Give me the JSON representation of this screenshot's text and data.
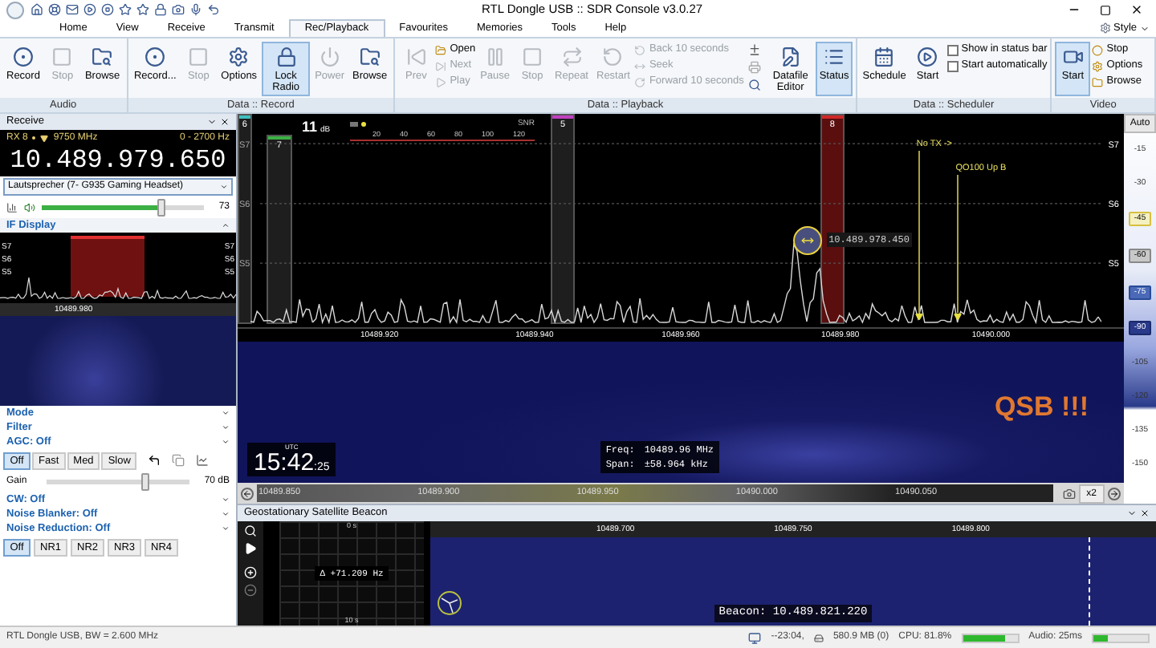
{
  "window": {
    "title": "RTL Dongle USB :: SDR Console v3.0.27"
  },
  "tabs": [
    {
      "label": "Home",
      "selected": false
    },
    {
      "label": "View",
      "selected": false
    },
    {
      "label": "Receive",
      "selected": false
    },
    {
      "label": "Transmit",
      "selected": false
    },
    {
      "label": "Rec/Playback",
      "selected": true
    },
    {
      "label": "Favourites",
      "selected": false
    },
    {
      "label": "Memories",
      "selected": false
    },
    {
      "label": "Tools",
      "selected": false
    },
    {
      "label": "Help",
      "selected": false
    }
  ],
  "style_menu": {
    "label": "Style"
  },
  "ribbon": {
    "groups": [
      {
        "label": "Audio",
        "items": [
          {
            "kind": "large",
            "label": "Record",
            "disabled": false,
            "selected": false
          },
          {
            "kind": "large",
            "label": "Stop",
            "disabled": true,
            "selected": false
          },
          {
            "kind": "large",
            "label": "Browse",
            "disabled": false,
            "selected": false
          }
        ]
      },
      {
        "label": "Data :: Record",
        "items": [
          {
            "kind": "large",
            "label": "Record...",
            "disabled": false,
            "selected": false
          },
          {
            "kind": "large",
            "label": "Stop",
            "disabled": true,
            "selected": false
          },
          {
            "kind": "large",
            "label": "Options",
            "disabled": false,
            "selected": false
          },
          {
            "kind": "large",
            "label": "Lock Radio",
            "disabled": false,
            "selected": true
          },
          {
            "kind": "large",
            "label": "Power",
            "disabled": true,
            "selected": false
          },
          {
            "kind": "large",
            "label": "Browse",
            "disabled": false,
            "selected": false
          }
        ]
      },
      {
        "label": "Data :: Playback",
        "items": [
          {
            "kind": "large",
            "label": "Prev",
            "disabled": true,
            "selected": false
          },
          {
            "kind": "small",
            "label": "Open",
            "disabled": false
          },
          {
            "kind": "small",
            "label": "Next",
            "disabled": true
          },
          {
            "kind": "small",
            "label": "Play",
            "disabled": true
          },
          {
            "kind": "large",
            "label": "Pause",
            "disabled": true,
            "selected": false
          },
          {
            "kind": "large",
            "label": "Stop",
            "disabled": true,
            "selected": false
          },
          {
            "kind": "large",
            "label": "Repeat",
            "disabled": true,
            "selected": false
          },
          {
            "kind": "large",
            "label": "Restart",
            "disabled": true,
            "selected": false
          },
          {
            "kind": "small",
            "label": "Back 10 seconds",
            "disabled": true
          },
          {
            "kind": "small",
            "label": "Seek",
            "disabled": true
          },
          {
            "kind": "small",
            "label": "Forward 10 seconds",
            "disabled": true
          },
          {
            "kind": "tools"
          },
          {
            "kind": "large",
            "label": "Datafile Editor",
            "disabled": false,
            "selected": false
          },
          {
            "kind": "large",
            "label": "Status",
            "disabled": false,
            "selected": true
          }
        ]
      },
      {
        "label": "Data :: Scheduler",
        "items": [
          {
            "kind": "large",
            "label": "Schedule",
            "disabled": false,
            "selected": false
          },
          {
            "kind": "large",
            "label": "Start",
            "disabled": false,
            "selected": false
          },
          {
            "kind": "check",
            "label": "Show in status bar",
            "checked": false
          },
          {
            "kind": "check",
            "label": "Start automatically",
            "checked": false
          }
        ]
      },
      {
        "label": "Video",
        "items": [
          {
            "kind": "large",
            "label": "Start",
            "disabled": false,
            "selected": true
          },
          {
            "kind": "small",
            "label": "Stop",
            "disabled": false
          },
          {
            "kind": "small",
            "label": "Options",
            "disabled": false
          },
          {
            "kind": "small",
            "label": "Browse",
            "disabled": false
          }
        ]
      }
    ]
  },
  "receive_panel": {
    "title": "Receive",
    "rx": "RX 8",
    "lo": "9750 MHz",
    "bandwidth": "0 - 2700 Hz",
    "frequency": "10.489.979.650",
    "audio_device": "Lautsprecher (7- G935 Gaming Headset)",
    "volume": {
      "level": 0.73,
      "reading": "73"
    },
    "if_display": {
      "title": "IF Display",
      "s_labels_left": [
        "S7",
        "S6",
        "S5"
      ],
      "s_labels_right": [
        "S7",
        "S6",
        "S5"
      ],
      "frequency_label": "10489.980"
    },
    "sections": [
      {
        "label": "Mode"
      },
      {
        "label": "Filter"
      },
      {
        "label": "AGC: Off"
      }
    ],
    "agc_buttons": [
      {
        "label": "Off",
        "selected": true
      },
      {
        "label": "Fast",
        "selected": false
      },
      {
        "label": "Med",
        "selected": false
      },
      {
        "label": "Slow",
        "selected": false
      }
    ],
    "gain": {
      "label": "Gain",
      "level": 0.68,
      "reading": "70 dB"
    },
    "sections2": [
      {
        "label": "CW: Off"
      },
      {
        "label": "Noise Blanker: Off"
      },
      {
        "label": "Noise Reduction: Off"
      }
    ],
    "nr_buttons": [
      {
        "label": "Off",
        "selected": true
      },
      {
        "label": "NR1",
        "selected": false
      },
      {
        "label": "NR2",
        "selected": false
      },
      {
        "label": "NR3",
        "selected": false
      },
      {
        "label": "NR4",
        "selected": false
      }
    ]
  },
  "spectrum": {
    "snr_reading": "11",
    "snr_unit": "dB",
    "snr_label": "SNR",
    "snr_ticks": [
      "20",
      "40",
      "60",
      "80",
      "100",
      "120"
    ],
    "s_labels_left": [
      "S7",
      "S6",
      "S5"
    ],
    "s_labels_right": [
      "S7",
      "S6",
      "S5"
    ],
    "bands": [
      {
        "label": "6",
        "color": "#3fbfbf",
        "selected": false
      },
      {
        "label": "7",
        "color": "#3cb043",
        "selected": false
      },
      {
        "label": "5",
        "color": "#c040c0",
        "selected": false
      },
      {
        "label": "8",
        "color": "#d02828",
        "selected": true
      }
    ],
    "cursor_readout": "10.489.978.450",
    "markers": [
      {
        "label": "No TX ->"
      },
      {
        "label": "QO100 Up B"
      }
    ],
    "axis_labels": [
      "10489.920",
      "10489.940",
      "10489.960",
      "10489.980",
      "10490.000"
    ]
  },
  "level_scale": {
    "mode": "Auto",
    "labels": [
      {
        "text": "-15",
        "kind": "tick"
      },
      {
        "text": "-30",
        "kind": "tick"
      },
      {
        "text": "-45",
        "kind": "handle"
      },
      {
        "text": "-60",
        "kind": "handle"
      },
      {
        "text": "-75",
        "kind": "handle"
      },
      {
        "text": "-90",
        "kind": "handle"
      },
      {
        "text": "-105",
        "kind": "tick"
      },
      {
        "text": "-120",
        "kind": "tick"
      },
      {
        "text": "-135",
        "kind": "tick"
      },
      {
        "text": "-150",
        "kind": "tick"
      }
    ]
  },
  "waterfall": {
    "clock": {
      "zone": "UTC",
      "time": "15:42",
      "seconds": ":25"
    },
    "info": [
      {
        "label": "Freq:",
        "value": "10489.96 MHz"
      },
      {
        "label": "Span:",
        "value": "±58.964 kHz"
      }
    ],
    "note": "QSB !!!"
  },
  "scroll_bar": {
    "labels": [
      "10489.850",
      "10489.900",
      "10489.950",
      "10490.000",
      "10490.050"
    ],
    "zoom": "x2"
  },
  "beacon_panel": {
    "title": "Geostationary Satellite Beacon",
    "time_labels": [
      "0 s",
      "10 s"
    ],
    "delta": "Δ +71.209 Hz",
    "axis_labels": [
      "10489.700",
      "10489.750",
      "10489.800"
    ],
    "beacon": "Beacon: 10.489.821.220"
  },
  "status_bar": {
    "left": "RTL Dongle USB, BW = 2.600 MHz",
    "time": "--23:04,",
    "memory": "580.9 MB (0)",
    "cpu": {
      "label": "CPU: 81.8%",
      "level": 0.78
    },
    "audio": {
      "label": "Audio: 25ms",
      "level": 0.25
    }
  }
}
